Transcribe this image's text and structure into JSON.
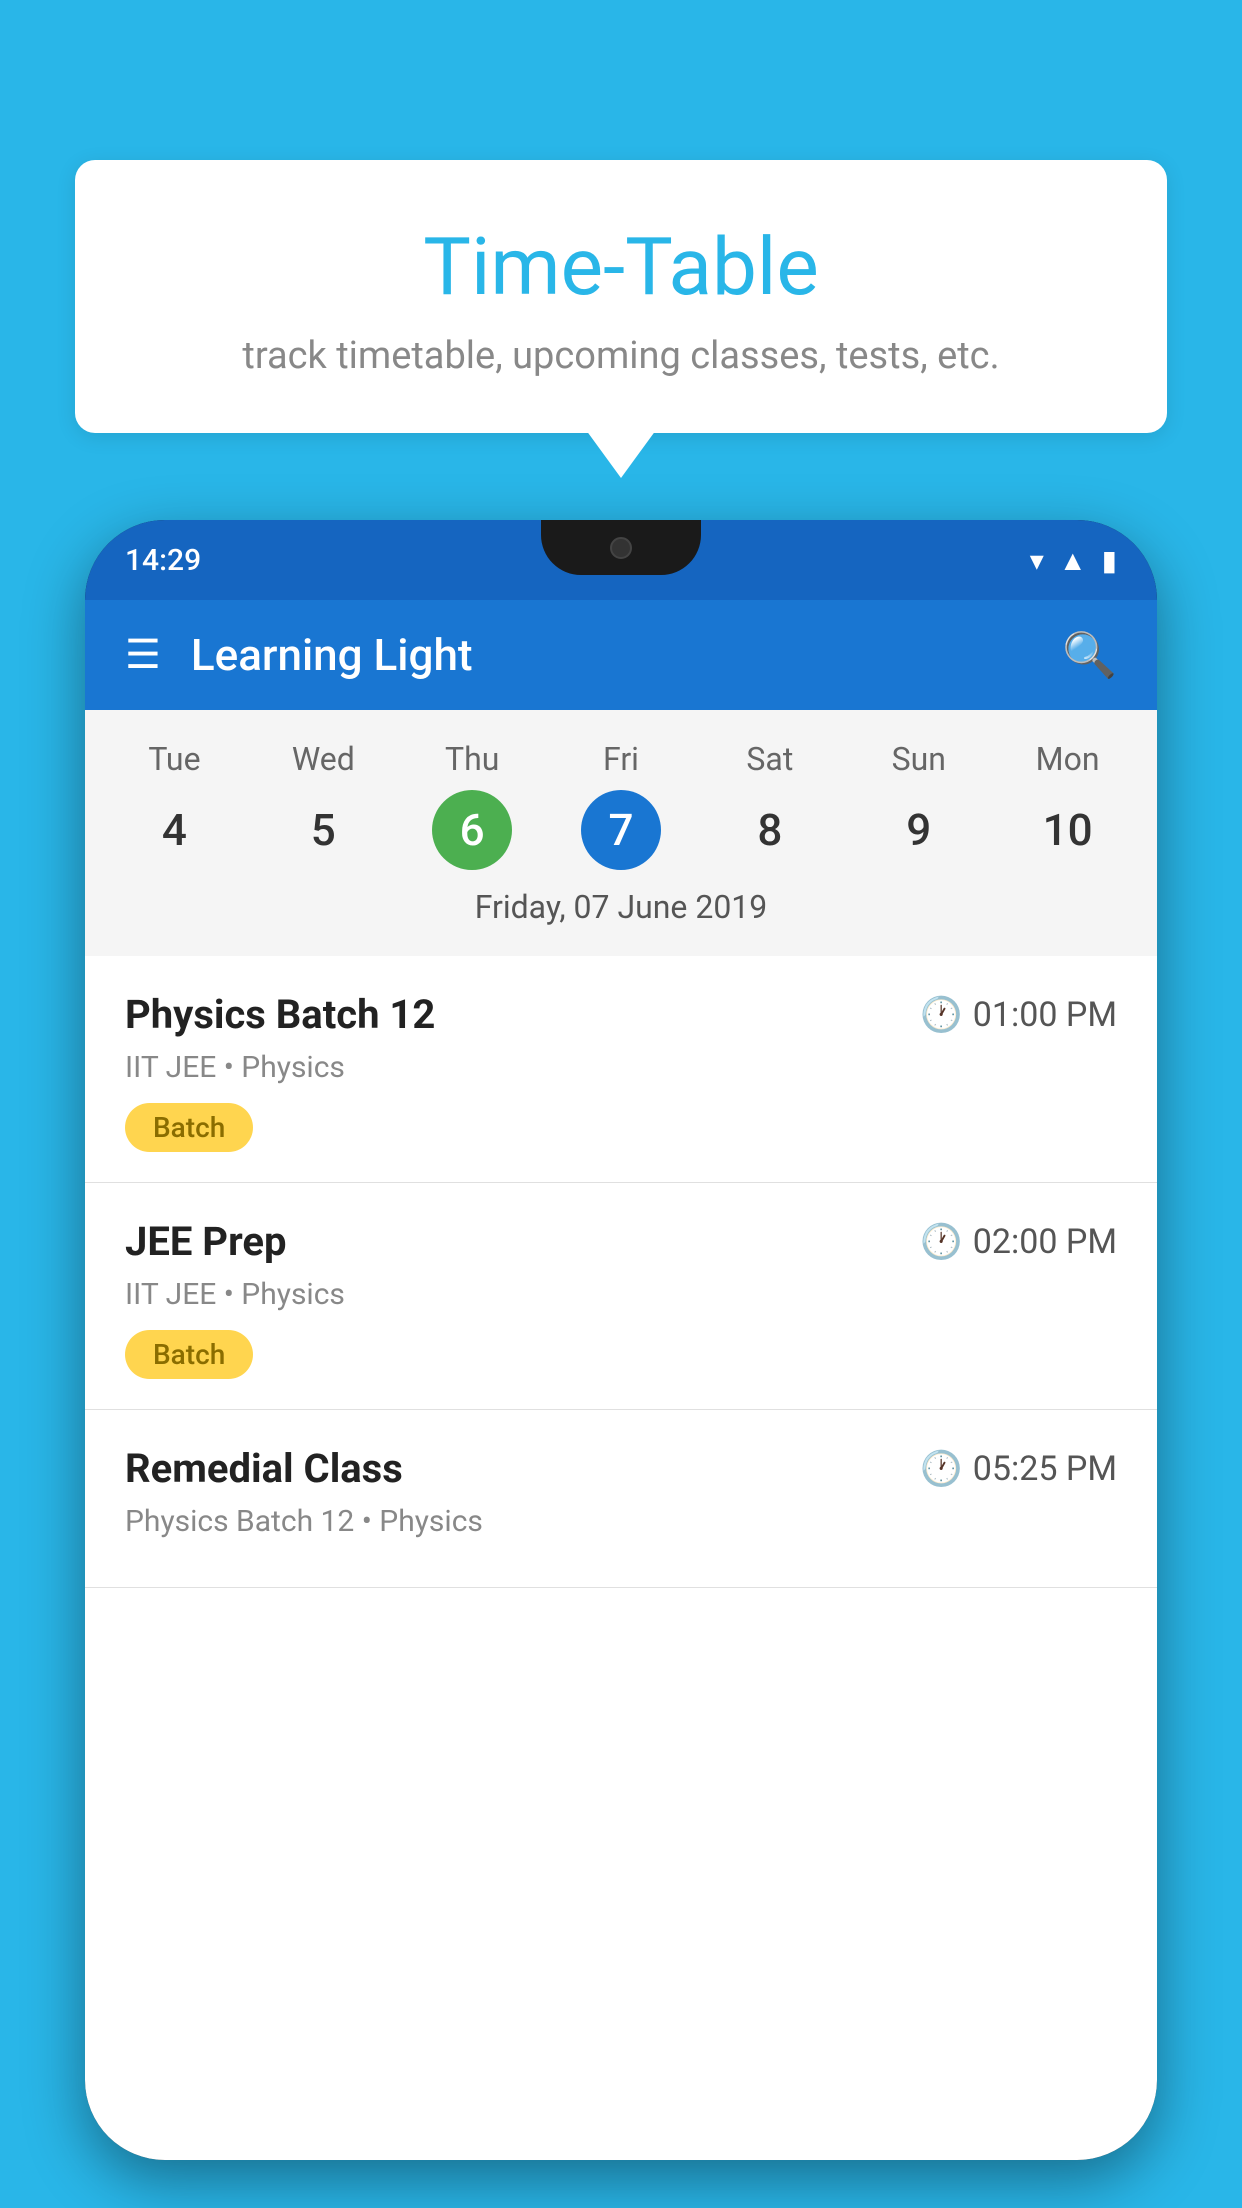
{
  "background_color": "#29b6e8",
  "speech_bubble": {
    "title": "Time-Table",
    "subtitle": "track timetable, upcoming classes, tests, etc."
  },
  "phone": {
    "status_bar": {
      "time": "14:29"
    },
    "app_bar": {
      "title": "Learning Light"
    },
    "calendar": {
      "days": [
        {
          "label": "Tue",
          "number": "4",
          "state": "normal"
        },
        {
          "label": "Wed",
          "number": "5",
          "state": "normal"
        },
        {
          "label": "Thu",
          "number": "6",
          "state": "today"
        },
        {
          "label": "Fri",
          "number": "7",
          "state": "selected"
        },
        {
          "label": "Sat",
          "number": "8",
          "state": "normal"
        },
        {
          "label": "Sun",
          "number": "9",
          "state": "normal"
        },
        {
          "label": "Mon",
          "number": "10",
          "state": "normal"
        }
      ],
      "selected_date_label": "Friday, 07 June 2019"
    },
    "schedule": [
      {
        "title": "Physics Batch 12",
        "time": "01:00 PM",
        "subtitle": "IIT JEE • Physics",
        "tag": "Batch"
      },
      {
        "title": "JEE Prep",
        "time": "02:00 PM",
        "subtitle": "IIT JEE • Physics",
        "tag": "Batch"
      },
      {
        "title": "Remedial Class",
        "time": "05:25 PM",
        "subtitle": "Physics Batch 12 • Physics",
        "tag": null
      }
    ]
  }
}
